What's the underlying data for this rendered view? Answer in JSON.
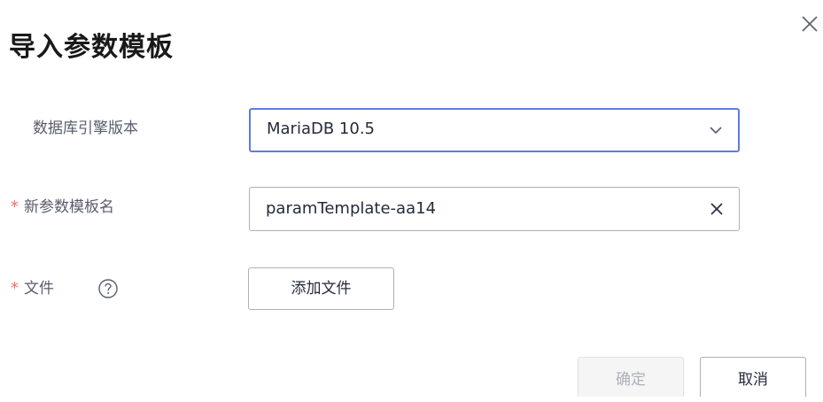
{
  "dialog": {
    "title": "导入参数模板",
    "close_icon": "close-icon"
  },
  "form": {
    "engine_version": {
      "label": "数据库引擎版本",
      "value": "MariaDB 10.5",
      "icon": "chevron-down-icon"
    },
    "template_name": {
      "required_mark": "*",
      "label": "新参数模板名",
      "value": "paramTemplate-aa14",
      "icon": "clear-icon"
    },
    "file": {
      "required_mark": "*",
      "label": "文件",
      "help_icon": "question-circle-icon",
      "button_label": "添加文件"
    }
  },
  "footer": {
    "confirm_label": "确定",
    "cancel_label": "取消"
  },
  "colors": {
    "accent": "#5e7ce0",
    "required": "#f66f6a",
    "disabled_text": "#adb0b8",
    "label_text": "#575d6c"
  }
}
